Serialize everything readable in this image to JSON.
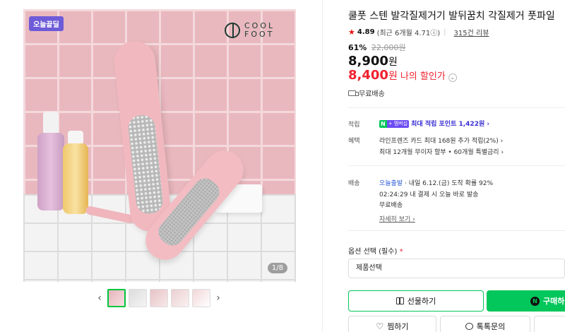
{
  "gallery": {
    "badge": "오늘끝딜",
    "brand": "COOL FOOT",
    "counter": "1/8",
    "prev_arrow": "‹",
    "next_arrow": "›"
  },
  "product": {
    "title": "쿨풋 스텐 발각질제거기 발뒤꿈치 각질제거 풋파일",
    "rating": "4.89",
    "rating_detail": "(최근 6개월 4.71ⓘ)",
    "review_count": "315건 리뷰",
    "discount_rate": "61%",
    "original_price": "22,000원",
    "price": "8,900",
    "price_unit": "원",
    "my_price": "8,400",
    "my_price_unit": "원",
    "my_price_label": "나의 할인가",
    "shipping_fee": "무료배송"
  },
  "benefits": {
    "point_label": "적립",
    "point_badge_n": "N",
    "point_badge_plus": "+ 멤버십",
    "point_text": "최대 적립 포인트 1,422원 ›",
    "benefit_label": "혜택",
    "benefit_line1": "라인프렌즈 카드 최대 168원 추가 적립(2%) ›",
    "benefit_line2": "최대 12개월 무이자 할부 • 60개월 특별금리 ›"
  },
  "delivery": {
    "label": "배송",
    "today_badge": "오늘출발",
    "line1": " · 내일 6.12.(금) 도착 확률 92%",
    "line2": "02:24:29  내 결제 시 오늘 바로 발송",
    "fee": "무료배송",
    "detail_link": "자세히 보기 ›"
  },
  "options": {
    "label": "옵션 선택 (필수)",
    "required_mark": "*",
    "select_value": "제품선택"
  },
  "actions": {
    "gift": "선물하기",
    "buy": "구매하",
    "buy_badge": "N",
    "wish": "찜하기",
    "talk": "톡톡문의"
  }
}
